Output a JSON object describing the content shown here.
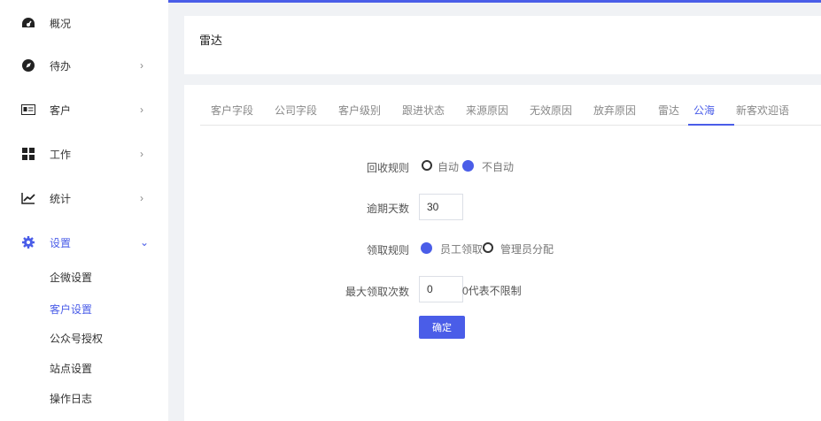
{
  "sidebar": {
    "items": [
      {
        "label": "概况",
        "icon": "dashboard-icon",
        "arrow": ""
      },
      {
        "label": "待办",
        "icon": "compass-icon",
        "arrow": "›"
      },
      {
        "label": "客户",
        "icon": "contact-card-icon",
        "arrow": "›"
      },
      {
        "label": "工作",
        "icon": "grid-icon",
        "arrow": "›"
      },
      {
        "label": "统计",
        "icon": "line-chart-icon",
        "arrow": "›"
      },
      {
        "label": "设置",
        "icon": "gear-icon",
        "arrow": "⌄"
      }
    ],
    "sub_items": [
      {
        "label": "企微设置"
      },
      {
        "label": "客户设置"
      },
      {
        "label": "公众号授权"
      },
      {
        "label": "站点设置"
      },
      {
        "label": "操作日志"
      }
    ]
  },
  "header": {
    "title": "雷达"
  },
  "tabs": [
    {
      "label": "客户字段"
    },
    {
      "label": "公司字段"
    },
    {
      "label": "客户级别"
    },
    {
      "label": "跟进状态"
    },
    {
      "label": "来源原因"
    },
    {
      "label": "无效原因"
    },
    {
      "label": "放弃原因"
    },
    {
      "label": "雷达"
    },
    {
      "label": "公海"
    },
    {
      "label": "新客欢迎语"
    }
  ],
  "form": {
    "recycle_rule": {
      "label": "回收规则",
      "options": [
        "自动",
        "不自动"
      ],
      "selected": "不自动"
    },
    "overdue_days": {
      "label": "逾期天数",
      "value": "30"
    },
    "claim_rule": {
      "label": "领取规则",
      "options": [
        "员工领取",
        "管理员分配"
      ],
      "selected": "员工领取"
    },
    "max_claims": {
      "label": "最大领取次数",
      "value": "0",
      "hint": "0代表不限制"
    },
    "submit_label": "确定"
  },
  "colors": {
    "accent": "#4a5de8"
  }
}
